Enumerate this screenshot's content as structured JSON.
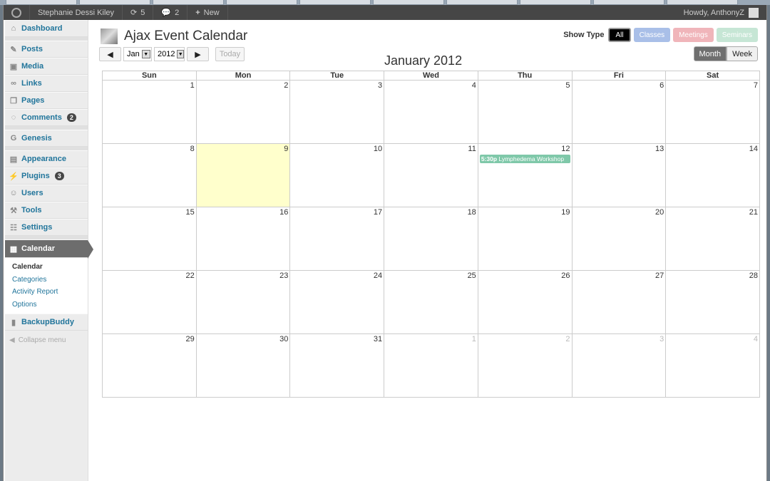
{
  "adminbar": {
    "site": "Stephanie Dessi Kiley",
    "updates": "5",
    "comments": "2",
    "new": "New",
    "howdy": "Howdy, AnthonyZ"
  },
  "sidebar": {
    "items": [
      {
        "label": "Dashboard",
        "icon": "home-icon"
      },
      {
        "label": "Posts",
        "icon": "pushpin-icon"
      },
      {
        "label": "Media",
        "icon": "media-icon"
      },
      {
        "label": "Links",
        "icon": "link-icon"
      },
      {
        "label": "Pages",
        "icon": "pages-icon"
      },
      {
        "label": "Comments",
        "icon": "comment-icon",
        "badge": "2"
      },
      {
        "label": "Genesis",
        "icon": "genesis-icon"
      },
      {
        "label": "Appearance",
        "icon": "appearance-icon"
      },
      {
        "label": "Plugins",
        "icon": "plugin-icon",
        "badge": "3"
      },
      {
        "label": "Users",
        "icon": "users-icon"
      },
      {
        "label": "Tools",
        "icon": "tools-icon"
      },
      {
        "label": "Settings",
        "icon": "settings-icon"
      },
      {
        "label": "Calendar",
        "icon": "calendar-icon"
      },
      {
        "label": "BackupBuddy",
        "icon": "backupbuddy-icon"
      }
    ],
    "submenu": [
      "Calendar",
      "Categories",
      "Activity Report",
      "Options"
    ],
    "collapse": "Collapse menu"
  },
  "calendar": {
    "title": "Ajax Event Calendar",
    "month_select": "Jan",
    "year_select": "2012",
    "today": "Today",
    "show_type_label": "Show Type",
    "types": [
      {
        "label": "All",
        "color": "#000000"
      },
      {
        "label": "Classes",
        "color": "#a9bfe8"
      },
      {
        "label": "Meetings",
        "color": "#f0b5ba"
      },
      {
        "label": "Seminars",
        "color": "#c6e6d5"
      }
    ],
    "views": [
      "Month",
      "Week"
    ],
    "month_title": "January 2012",
    "weekdays": [
      "Sun",
      "Mon",
      "Tue",
      "Wed",
      "Thu",
      "Fri",
      "Sat"
    ],
    "weeks": [
      [
        1,
        2,
        3,
        4,
        5,
        6,
        7
      ],
      [
        8,
        9,
        10,
        11,
        12,
        13,
        14
      ],
      [
        15,
        16,
        17,
        18,
        19,
        20,
        21
      ],
      [
        22,
        23,
        24,
        25,
        26,
        27,
        28
      ],
      [
        29,
        30,
        31,
        1,
        2,
        3,
        4
      ]
    ],
    "highlighted_day": 9,
    "events": [
      {
        "day": 12,
        "time": "5:30p",
        "title": "Lymphedema Workshop",
        "color": "#7fc8a9"
      }
    ]
  }
}
